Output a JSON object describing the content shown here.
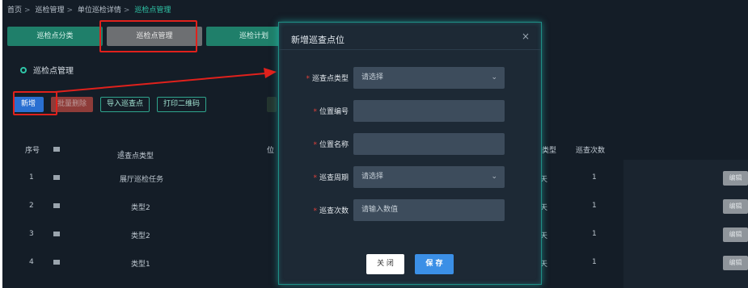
{
  "breadcrumb": [
    "首页",
    "巡检管理",
    "单位巡检详情",
    "巡检点管理"
  ],
  "tabs": [
    {
      "label": "巡检点分类",
      "active": false
    },
    {
      "label": "巡检点管理",
      "active": true
    },
    {
      "label": "巡检计划",
      "active": false
    }
  ],
  "section_title": "巡检点管理",
  "toolbar": {
    "add": "新增",
    "batch_delete": "批量删除",
    "import": "导入巡查点",
    "print_qr": "打印二维码"
  },
  "table": {
    "headers": {
      "index": "序号",
      "checkbox": "■...",
      "point_type": "巡查点类型",
      "sort_icon": "⇕",
      "position_prefix": "位",
      "cycle_tail": "类型",
      "count": "巡查次数"
    },
    "rows": [
      {
        "index": "1",
        "checkbox": "■...",
        "type": "展厅巡检任务",
        "cycle": "天",
        "count": "1",
        "edit": "编辑"
      },
      {
        "index": "2",
        "checkbox": "■...",
        "type": "类型2",
        "cycle": "天",
        "count": "1",
        "edit": "编辑"
      },
      {
        "index": "3",
        "checkbox": "■...",
        "type": "类型2",
        "cycle": "天",
        "count": "1",
        "edit": "编辑"
      },
      {
        "index": "4",
        "checkbox": "■...",
        "type": "类型1",
        "cycle": "天",
        "count": "1",
        "edit": "编辑"
      }
    ]
  },
  "modal": {
    "title": "新增巡查点位",
    "close_icon": "×",
    "fields": [
      {
        "label": "巡查点类型",
        "value": "请选择",
        "kind": "select"
      },
      {
        "label": "位置编号",
        "value": "",
        "kind": "input"
      },
      {
        "label": "位置名称",
        "value": "",
        "kind": "input"
      },
      {
        "label": "巡查周期",
        "value": "请选择",
        "kind": "select"
      },
      {
        "label": "巡查次数",
        "value": "请输入数值",
        "kind": "input"
      }
    ],
    "required_mark": "*",
    "chevron": "⌄",
    "close_button": "关 闭",
    "save_button": "保 存"
  },
  "colors": {
    "background": "#141d27",
    "accent": "#2fc6a8",
    "highlight": "#e0211c",
    "primary": "#3b8fe6"
  }
}
